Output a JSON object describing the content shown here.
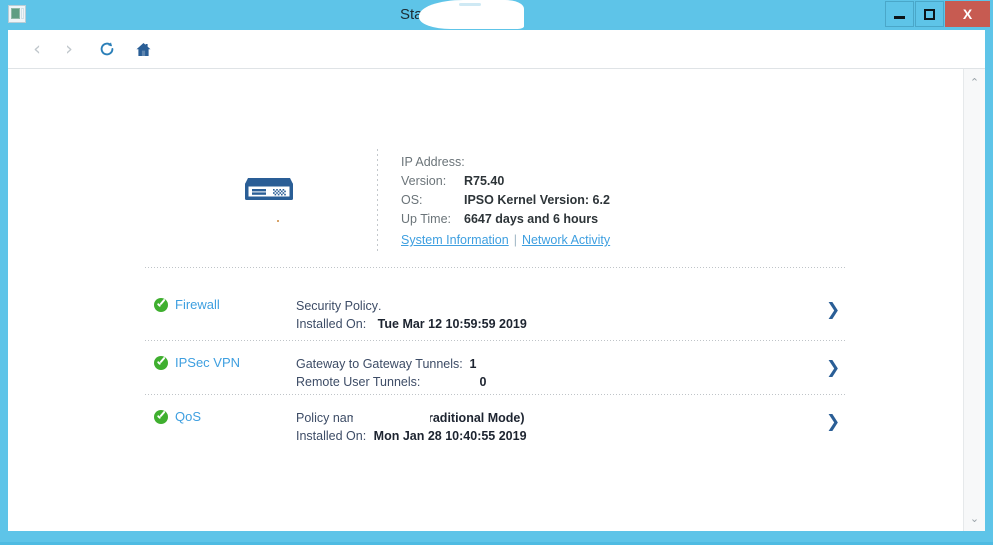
{
  "window": {
    "title_visible": "Status",
    "app_icon": "application-icon",
    "controls": {
      "minimize": "minimize-button",
      "maximize": "maximize-button",
      "close_label": "X"
    }
  },
  "toolbar": {
    "back": "‹",
    "forward": "›",
    "reload": "reload-icon",
    "home": "home-icon"
  },
  "header": {
    "device_icon": "network-appliance-icon",
    "info": [
      {
        "label": "IP Address:",
        "value": ""
      },
      {
        "label": "Version:",
        "value": "R75.40"
      },
      {
        "label": "OS:",
        "value": "IPSO Kernel Version: 6.2"
      },
      {
        "label": "Up Time:",
        "value": "6647 days and 6 hours"
      }
    ],
    "links": {
      "system_information": "System Information",
      "separator": "|",
      "network_activity": "Network Activity"
    }
  },
  "blades": [
    {
      "name": "Firewall",
      "status": "ok",
      "details": [
        {
          "key": "Security Policy:",
          "value": ""
        },
        {
          "key": "Installed On:",
          "value": "Tue Mar 12 10:59:59 2019"
        }
      ],
      "arrow": "❯"
    },
    {
      "name": "IPSec VPN",
      "status": "ok",
      "details": [
        {
          "key": "Gateway to Gateway Tunnels:",
          "value": "1"
        },
        {
          "key": "Remote User Tunnels:",
          "value": "0"
        }
      ],
      "arrow": "❯"
    },
    {
      "name": "QoS",
      "status": "ok",
      "details": [
        {
          "key": "Policy name:",
          "value": "Traditional Mode)"
        },
        {
          "key": "Installed On:",
          "value": "Mon Jan 28 10:40:55 2019"
        }
      ],
      "arrow": "❯"
    }
  ],
  "scrollbar": {
    "up": "⌃",
    "down": "⌄"
  },
  "colors": {
    "window_chrome": "#5ec4e8",
    "close_button": "#c75b51",
    "link": "#3e9fe0",
    "status_ok": "#3faf2f",
    "arrow": "#2a5e96",
    "icon_blue": "#2a5e96"
  }
}
